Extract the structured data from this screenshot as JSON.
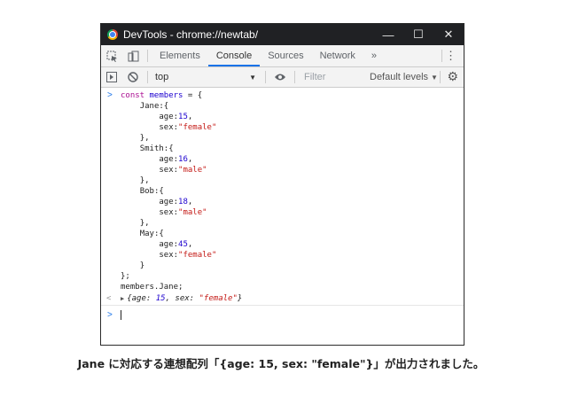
{
  "window": {
    "title": "DevTools - chrome://newtab/",
    "controls": [
      "—",
      "☐",
      "✕"
    ]
  },
  "tabs": [
    {
      "label": "Elements",
      "active": false
    },
    {
      "label": "Console",
      "active": true
    },
    {
      "label": "Sources",
      "active": false
    },
    {
      "label": "Network",
      "active": false
    }
  ],
  "tabs_more": "»",
  "menu_icon": "⋮",
  "filterbar": {
    "context": "top",
    "filter_placeholder": "Filter",
    "levels": "Default levels"
  },
  "console": {
    "prompt_symbol": ">",
    "code": [
      {
        "indent": "",
        "parts": [
          [
            "kw",
            "const "
          ],
          [
            "var",
            "members"
          ],
          [
            "prop",
            " = {"
          ]
        ]
      },
      {
        "indent": "    ",
        "parts": [
          [
            "prop",
            "Jane:{"
          ]
        ]
      },
      {
        "indent": "        ",
        "parts": [
          [
            "prop",
            "age:"
          ],
          [
            "num",
            "15"
          ],
          [
            "prop",
            ","
          ]
        ]
      },
      {
        "indent": "        ",
        "parts": [
          [
            "prop",
            "sex:"
          ],
          [
            "str",
            "\"female\""
          ]
        ]
      },
      {
        "indent": "    ",
        "parts": [
          [
            "prop",
            "},"
          ]
        ]
      },
      {
        "indent": "    ",
        "parts": [
          [
            "prop",
            "Smith:{"
          ]
        ]
      },
      {
        "indent": "        ",
        "parts": [
          [
            "prop",
            "age:"
          ],
          [
            "num",
            "16"
          ],
          [
            "prop",
            ","
          ]
        ]
      },
      {
        "indent": "        ",
        "parts": [
          [
            "prop",
            "sex:"
          ],
          [
            "str",
            "\"male\""
          ]
        ]
      },
      {
        "indent": "    ",
        "parts": [
          [
            "prop",
            "},"
          ]
        ]
      },
      {
        "indent": "    ",
        "parts": [
          [
            "prop",
            "Bob:{"
          ]
        ]
      },
      {
        "indent": "        ",
        "parts": [
          [
            "prop",
            "age:"
          ],
          [
            "num",
            "18"
          ],
          [
            "prop",
            ","
          ]
        ]
      },
      {
        "indent": "        ",
        "parts": [
          [
            "prop",
            "sex:"
          ],
          [
            "str",
            "\"male\""
          ]
        ]
      },
      {
        "indent": "    ",
        "parts": [
          [
            "prop",
            "},"
          ]
        ]
      },
      {
        "indent": "    ",
        "parts": [
          [
            "prop",
            "May:{"
          ]
        ]
      },
      {
        "indent": "        ",
        "parts": [
          [
            "prop",
            "age:"
          ],
          [
            "num",
            "45"
          ],
          [
            "prop",
            ","
          ]
        ]
      },
      {
        "indent": "        ",
        "parts": [
          [
            "prop",
            "sex:"
          ],
          [
            "str",
            "\"female\""
          ]
        ]
      },
      {
        "indent": "    ",
        "parts": [
          [
            "prop",
            "}"
          ]
        ]
      },
      {
        "indent": "",
        "parts": [
          [
            "prop",
            "};"
          ]
        ]
      },
      {
        "indent": "",
        "parts": [
          [
            "prop",
            "members.Jane;"
          ]
        ]
      }
    ],
    "result_arrow": "<",
    "result": {
      "prefix": "{age: ",
      "age": "15",
      "mid": ", sex: ",
      "sex": "\"female\"",
      "suffix": "}"
    },
    "input_value": ""
  },
  "caption": "Jane に対応する連想配列「{age: 15, sex: \"female\"}」が出力されました。"
}
